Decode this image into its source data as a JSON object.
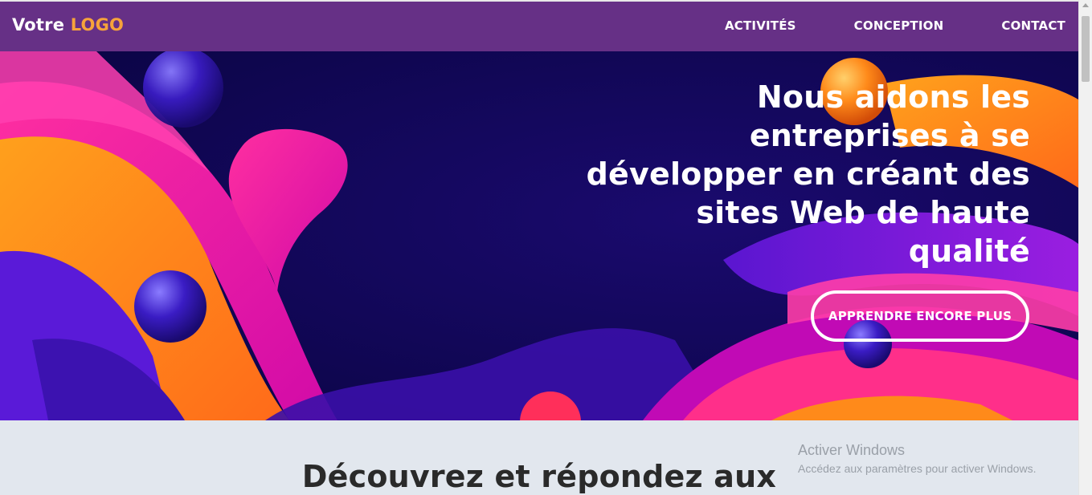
{
  "header": {
    "logo_prefix": "Votre",
    "logo_accent": "LOGO",
    "nav": [
      "ACTIVITÉS",
      "CONCEPTION",
      "CONTACT"
    ]
  },
  "hero": {
    "headline": "Nous aidons les entreprises à se développer en créant des sites Web de haute qualité",
    "cta_label": "APPRENDRE ENCORE PLUS"
  },
  "section": {
    "title": "Découvrez et répondez aux"
  },
  "watermark": {
    "title": "Activer Windows",
    "subtitle": "Accédez aux paramètres pour activer Windows."
  },
  "colors": {
    "header_bg": "#663086",
    "logo_accent": "#f7a33b",
    "hero_bg": "#120a5a",
    "section_bg": "#e2e7ee"
  }
}
